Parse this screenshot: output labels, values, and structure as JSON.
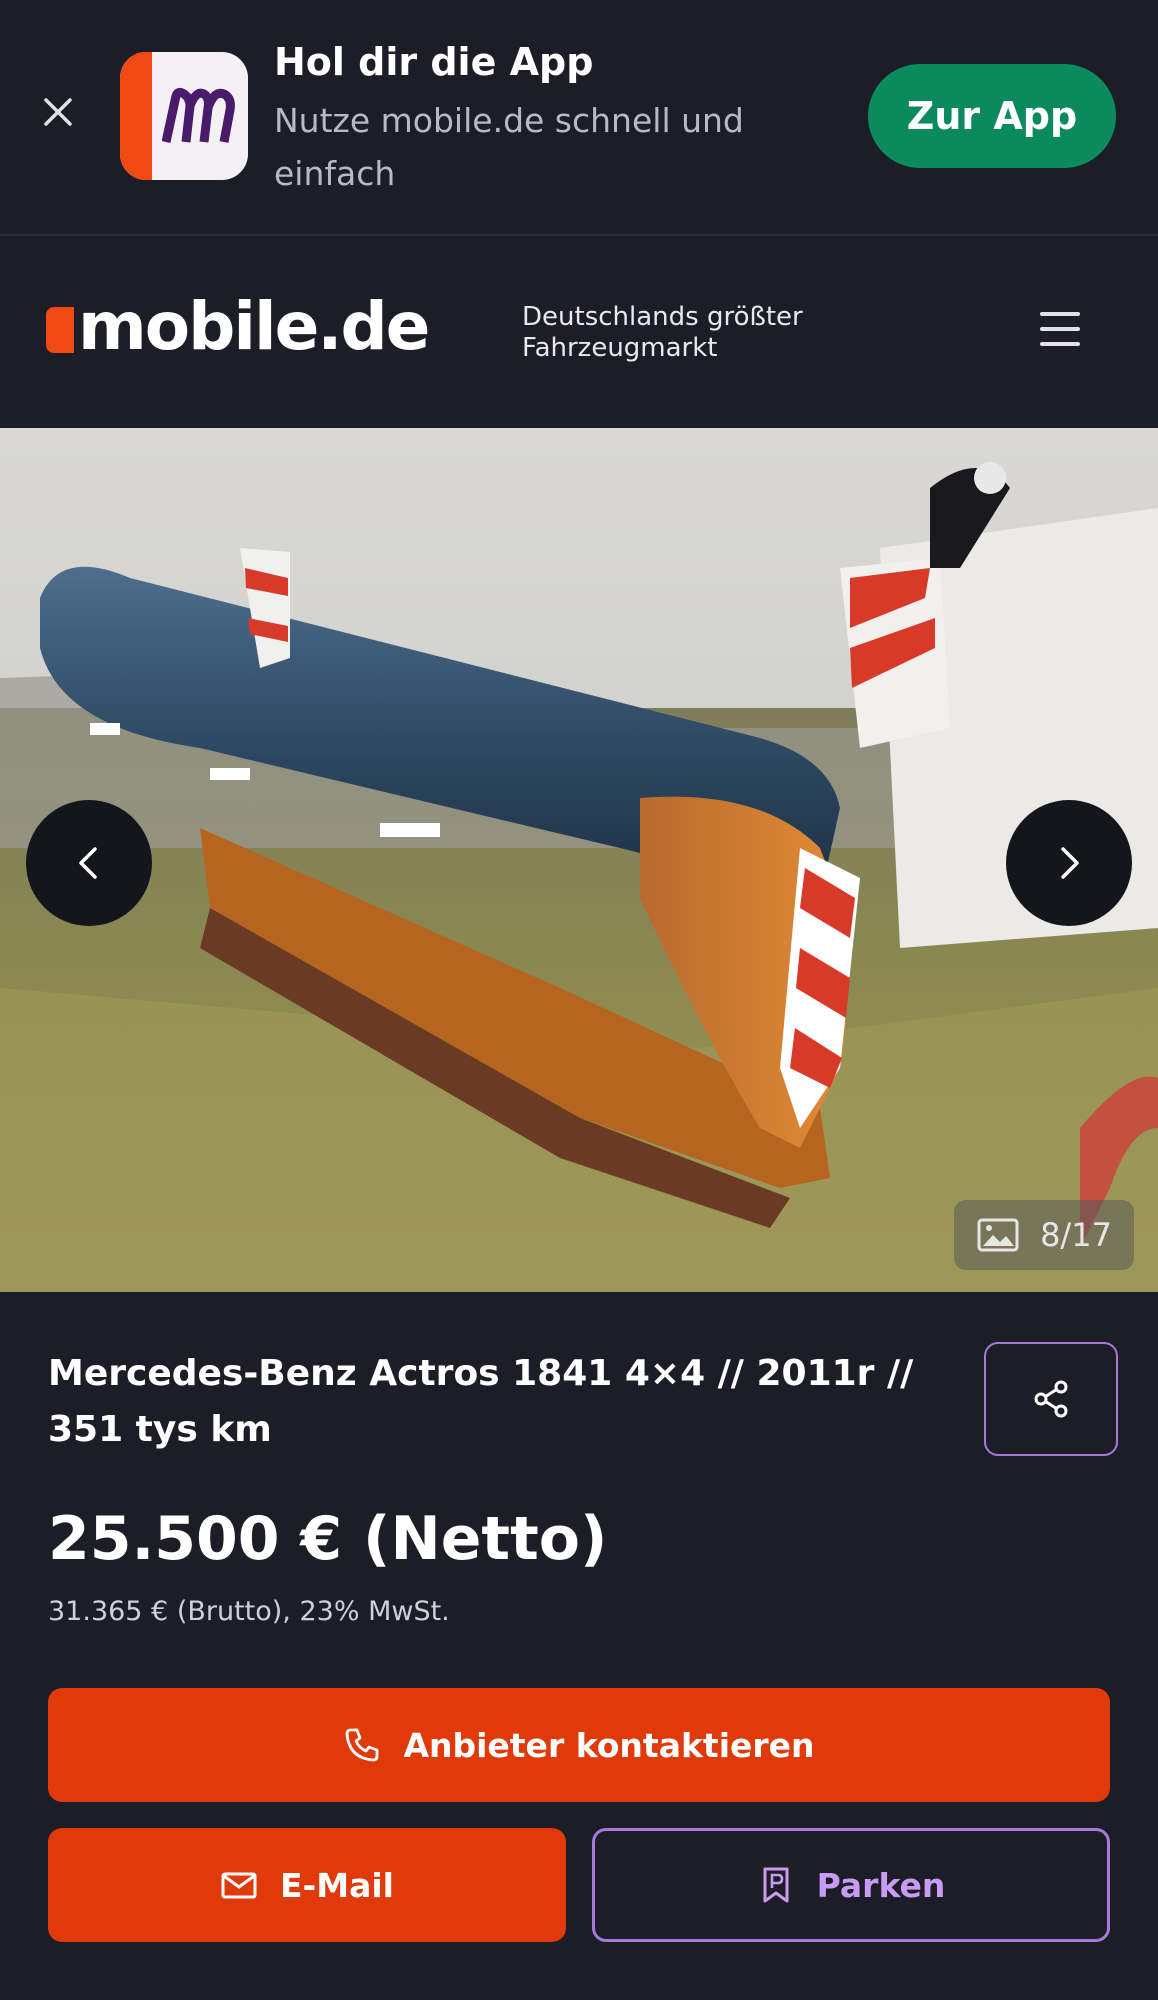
{
  "app_banner": {
    "title": "Hol dir die App",
    "subtitle": "Nutze mobile.de schnell und einfach",
    "cta": "Zur App",
    "icon_letter": "m"
  },
  "header": {
    "logo": "mobile.de",
    "tagline_line1": "Deutschlands größter",
    "tagline_line2": "Fahrzeugmarkt"
  },
  "gallery": {
    "counter": "8/17",
    "current_index": 8,
    "total": 17
  },
  "listing": {
    "title": "Mercedes-Benz Actros 1841 4×4 // 2011r // 351 tys km",
    "price_net": "25.500 € (Netto)",
    "price_gross": "31.365 € (Brutto), 23% MwSt."
  },
  "actions": {
    "contact": "Anbieter kontaktieren",
    "email": "E-Mail",
    "park": "Parken"
  },
  "colors": {
    "background": "#1d1d27",
    "brand_orange": "#ef4a12",
    "cta_green": "#0a8a5d",
    "accent_purple": "#a67ad9"
  },
  "icons": [
    "close-icon",
    "mobile-de-app-icon",
    "hamburger-menu-icon",
    "chevron-left-icon",
    "chevron-right-icon",
    "image-icon",
    "share-icon",
    "phone-icon",
    "mail-icon",
    "bookmark-icon"
  ]
}
